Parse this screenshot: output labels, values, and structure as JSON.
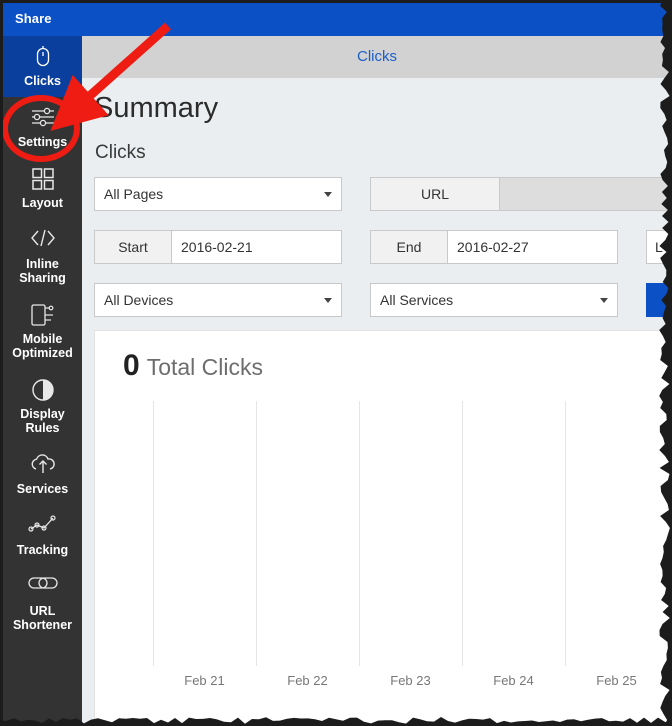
{
  "window": {
    "title": "Share"
  },
  "sidebar": {
    "items": [
      {
        "label": "Clicks",
        "icon": "mouse-icon",
        "active": true
      },
      {
        "label": "Settings",
        "icon": "sliders-icon",
        "active": false
      },
      {
        "label": "Layout",
        "icon": "grid-icon",
        "active": false
      },
      {
        "label": "Inline\nSharing",
        "icon": "code-icon",
        "active": false
      },
      {
        "label": "Mobile\nOptimized",
        "icon": "mobile-icon",
        "active": false
      },
      {
        "label": "Display\nRules",
        "icon": "contrast-circle-icon",
        "active": false
      },
      {
        "label": "Services",
        "icon": "cloud-upload-icon",
        "active": false
      },
      {
        "label": "Tracking",
        "icon": "line-chart-icon",
        "active": false
      },
      {
        "label": "URL\nShortener",
        "icon": "link-chain-icon",
        "active": false
      }
    ]
  },
  "tabbar": {
    "clicks_tab": "Clicks"
  },
  "main": {
    "page_title": "Summary",
    "section_title": "Clicks",
    "filters": {
      "pages_select": "All Pages",
      "url_addon": "URL",
      "url_value": "",
      "start_addon": "Start",
      "start_value": "2016-02-21",
      "end_addon": "End",
      "end_value": "2016-02-27",
      "limit_addon": "L",
      "limit_value": "",
      "devices_select": "All Devices",
      "services_select": "All Services",
      "submit_label": ""
    }
  },
  "chart_data": {
    "type": "bar",
    "title": "Total Clicks",
    "total": "0",
    "total_label": "Total Clicks",
    "categories": [
      "Feb 21",
      "Feb 22",
      "Feb 23",
      "Feb 24",
      "Feb 25"
    ],
    "values": [
      0,
      0,
      0,
      0,
      0
    ],
    "xlabel": "",
    "ylabel": "",
    "ylim": [
      0,
      1
    ],
    "grid": true,
    "legend": "none"
  },
  "annotation": {
    "arrow_color": "#ee1c12",
    "ellipse_target": "Settings"
  },
  "colors": {
    "header_blue": "#0b50c4",
    "sidebar_dark": "#333333",
    "sidebar_active": "#0b3f9e",
    "main_bg": "#eaeef0",
    "tab_link": "#1a5fc8",
    "annotation_red": "#ee1c12"
  }
}
